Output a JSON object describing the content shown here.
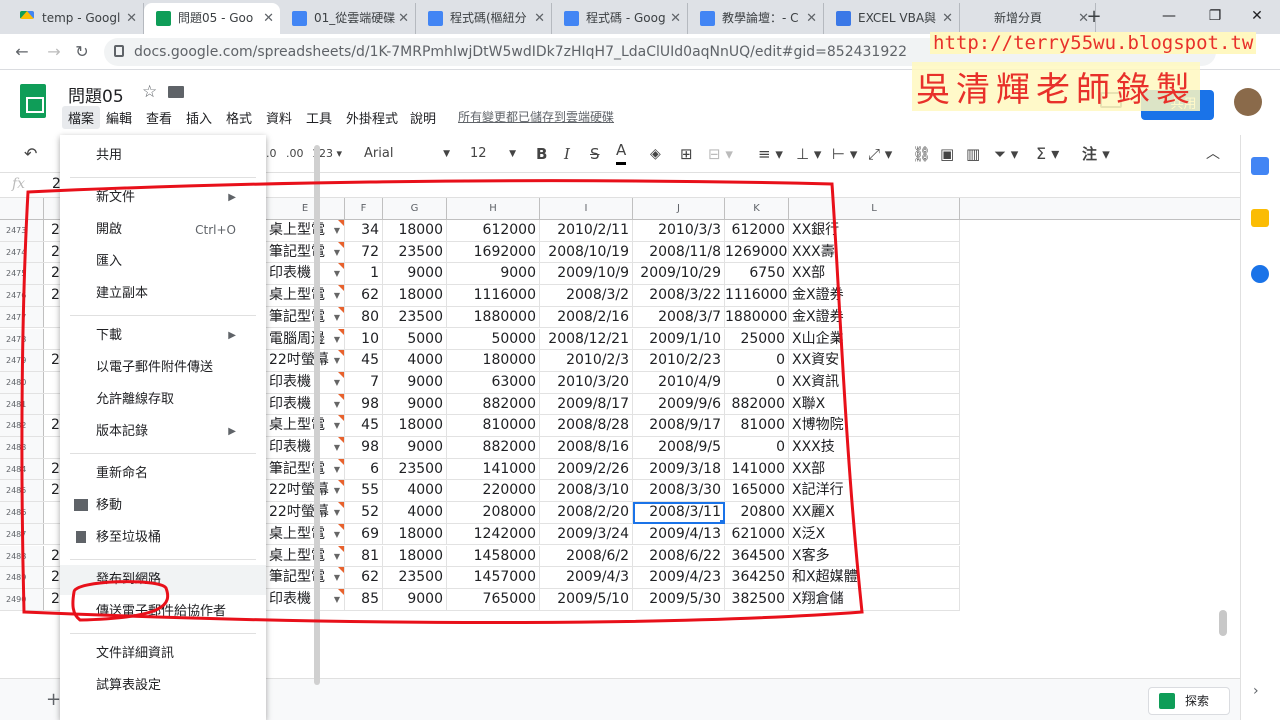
{
  "browser": {
    "tabs": [
      {
        "title": "temp - Googl",
        "icon": "drive-icon"
      },
      {
        "title": "問題05 - Goo",
        "icon": "sheets-icon",
        "active": true
      },
      {
        "title": "01_從雲端硬碟",
        "icon": "docs-icon"
      },
      {
        "title": "程式碼(樞紐分",
        "icon": "docs-icon"
      },
      {
        "title": "程式碼 - Goog",
        "icon": "docs-icon"
      },
      {
        "title": "教學論壇：- C",
        "icon": "docs-icon"
      },
      {
        "title": "EXCEL VBA與",
        "icon": "vba-icon"
      },
      {
        "title": "新增分頁",
        "icon": ""
      }
    ],
    "url": "docs.google.com/spreadsheets/d/1K-7MRPmhIwjDtW5wdIDk7zHIqH7_LdaClUId0aqNnUQ/edit#gid=852431922"
  },
  "watermark": {
    "url": "http://terry55wu.blogspot.tw",
    "name": "吳清輝老師錄製"
  },
  "doc": {
    "title": "問題05",
    "menus": [
      "檔案",
      "編輯",
      "查看",
      "插入",
      "格式",
      "資料",
      "工具",
      "外掛程式",
      "說明"
    ],
    "saved_status": "所有變更都已儲存到雲端硬碟",
    "share_label": "共用"
  },
  "toolbar": {
    "decimal_dec": ".0",
    "decimal_inc": ".00",
    "format_more": "123",
    "font": "Arial",
    "size": "12",
    "bold": "B",
    "italic": "I",
    "strike": "S",
    "text_color": "A",
    "sigma": "Σ",
    "input_tools": "注"
  },
  "formula_bar": {
    "fx": "fx",
    "value": "2"
  },
  "grid": {
    "columns": [
      "E",
      "F",
      "G",
      "H",
      "I",
      "J",
      "K",
      "L"
    ],
    "row_numbers": [
      "2473",
      "2474",
      "2475",
      "2476",
      "2477",
      "2478",
      "2479",
      "2480",
      "2481",
      "2482",
      "2483",
      "2484",
      "2485",
      "2486",
      "2487",
      "2488",
      "2489",
      "2490"
    ],
    "a_stub": [
      "2",
      "2",
      "2",
      "2",
      "",
      "",
      "2",
      "",
      "",
      "2",
      "",
      "2",
      "2",
      "",
      "",
      "2",
      "2",
      "2"
    ],
    "rows": [
      [
        "桌上型電",
        "34",
        "18000",
        "612000",
        "2010/2/11",
        "2010/3/3",
        "612000",
        "XX銀行"
      ],
      [
        "筆記型電",
        "72",
        "23500",
        "1692000",
        "2008/10/19",
        "2008/11/8",
        "1269000",
        "XXX壽"
      ],
      [
        "印表機",
        "1",
        "9000",
        "9000",
        "2009/10/9",
        "2009/10/29",
        "6750",
        "XX部"
      ],
      [
        "桌上型電",
        "62",
        "18000",
        "1116000",
        "2008/3/2",
        "2008/3/22",
        "1116000",
        "金X證券"
      ],
      [
        "筆記型電",
        "80",
        "23500",
        "1880000",
        "2008/2/16",
        "2008/3/7",
        "1880000",
        "金X證券"
      ],
      [
        "電腦周邊",
        "10",
        "5000",
        "50000",
        "2008/12/21",
        "2009/1/10",
        "25000",
        "X山企業"
      ],
      [
        "22吋螢幕",
        "45",
        "4000",
        "180000",
        "2010/2/3",
        "2010/2/23",
        "0",
        "XX資安"
      ],
      [
        "印表機",
        "7",
        "9000",
        "63000",
        "2010/3/20",
        "2010/4/9",
        "0",
        "XX資訊"
      ],
      [
        "印表機",
        "98",
        "9000",
        "882000",
        "2009/8/17",
        "2009/9/6",
        "882000",
        "X聯X"
      ],
      [
        "桌上型電",
        "45",
        "18000",
        "810000",
        "2008/8/28",
        "2008/9/17",
        "81000",
        "X博物院"
      ],
      [
        "印表機",
        "98",
        "9000",
        "882000",
        "2008/8/16",
        "2008/9/5",
        "0",
        "XXX技"
      ],
      [
        "筆記型電",
        "6",
        "23500",
        "141000",
        "2009/2/26",
        "2009/3/18",
        "141000",
        "XX部"
      ],
      [
        "22吋螢幕",
        "55",
        "4000",
        "220000",
        "2008/3/10",
        "2008/3/30",
        "165000",
        "X記洋行"
      ],
      [
        "22吋螢幕",
        "52",
        "4000",
        "208000",
        "2008/2/20",
        "2008/3/11",
        "20800",
        "XX麗X"
      ],
      [
        "桌上型電",
        "69",
        "18000",
        "1242000",
        "2009/3/24",
        "2009/4/13",
        "621000",
        "X泛X"
      ],
      [
        "桌上型電",
        "81",
        "18000",
        "1458000",
        "2008/6/2",
        "2008/6/22",
        "364500",
        "X客多"
      ],
      [
        "筆記型電",
        "62",
        "23500",
        "1457000",
        "2009/4/3",
        "2009/4/23",
        "364250",
        "和X超媒體"
      ],
      [
        "印表機",
        "85",
        "9000",
        "765000",
        "2009/5/10",
        "2009/5/30",
        "382500",
        "X翔倉儲"
      ]
    ],
    "selected": {
      "row": 13,
      "col": 5
    }
  },
  "file_menu": {
    "items": [
      {
        "label": "共用",
        "name": "menu-share"
      },
      {
        "sep": true
      },
      {
        "label": "新文件",
        "name": "menu-new",
        "arrow": "▶"
      },
      {
        "label": "開啟",
        "name": "menu-open",
        "shortcut": "Ctrl+O"
      },
      {
        "label": "匯入",
        "name": "menu-import"
      },
      {
        "label": "建立副本",
        "name": "menu-make-copy"
      },
      {
        "sep": true
      },
      {
        "label": "下載",
        "name": "menu-download",
        "arrow": "▶"
      },
      {
        "label": "以電子郵件附件傳送",
        "name": "menu-email-attachment"
      },
      {
        "label": "允許離線存取",
        "name": "menu-offline"
      },
      {
        "label": "版本記錄",
        "name": "menu-version-history",
        "arrow": "▶"
      },
      {
        "sep": true
      },
      {
        "label": "重新命名",
        "name": "menu-rename"
      },
      {
        "label": "移動",
        "name": "menu-move",
        "icon": "folder-icon"
      },
      {
        "label": "移至垃圾桶",
        "name": "menu-trash",
        "icon": "trash-icon"
      },
      {
        "sep": true
      },
      {
        "label": "發布到網路",
        "name": "menu-publish-web",
        "highlight": true
      },
      {
        "label": "傳送電子郵件給協作者",
        "name": "menu-email-collaborators"
      },
      {
        "sep": true
      },
      {
        "label": "文件詳細資訊",
        "name": "menu-doc-details"
      },
      {
        "label": "試算表設定",
        "name": "menu-spreadsheet-settings"
      }
    ]
  },
  "bottom": {
    "explore_label": "探索"
  },
  "colors": {
    "accent": "#1a73e8",
    "sheets_green": "#0f9d58",
    "annotation_red": "#e8101a"
  }
}
